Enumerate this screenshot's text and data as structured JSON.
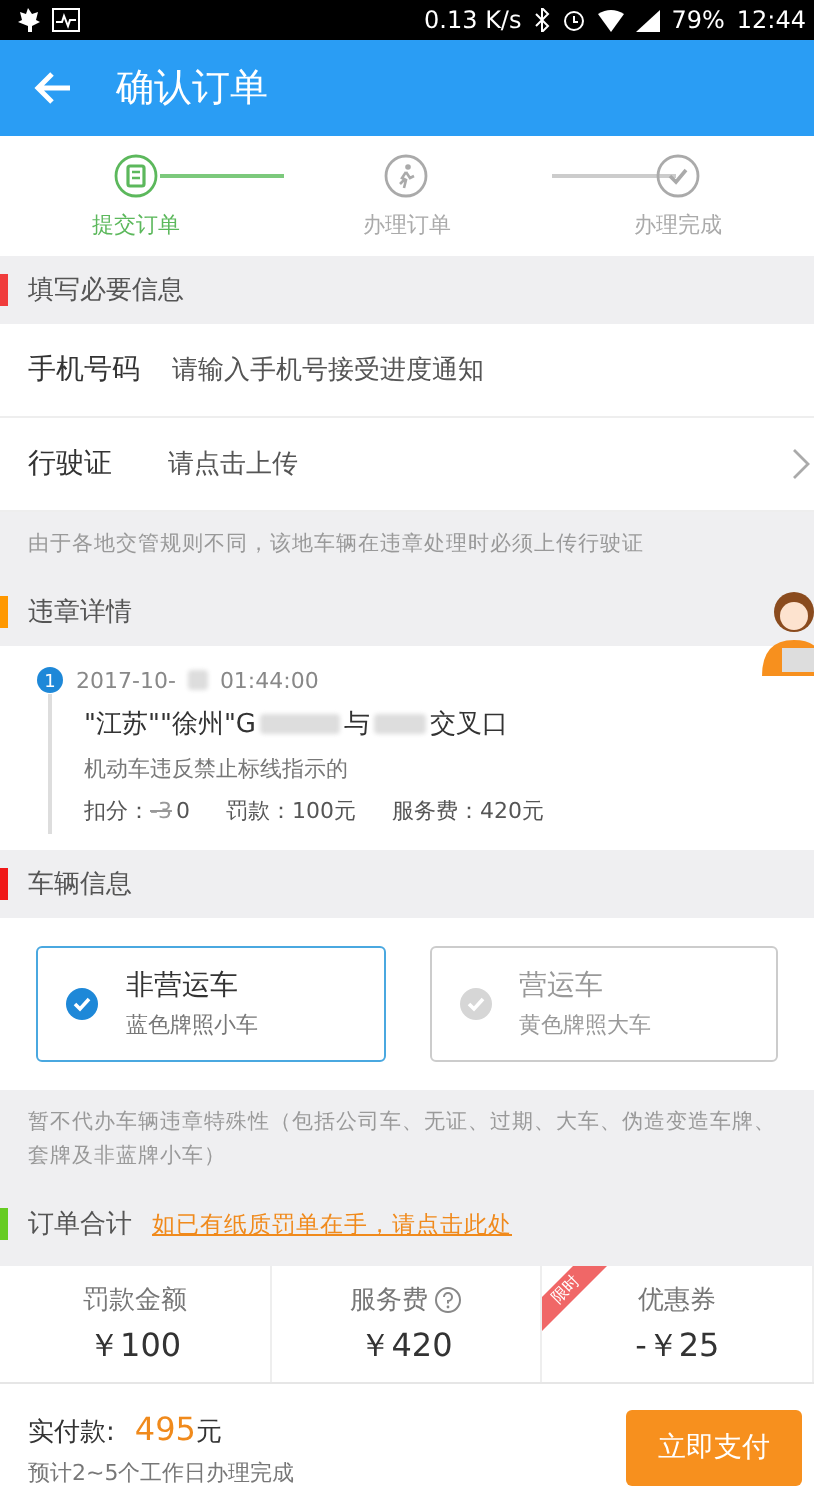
{
  "status_bar": {
    "speed": "0.13 K/s",
    "battery": "79%",
    "time": "12:44"
  },
  "header": {
    "title": "确认订单"
  },
  "steps": [
    {
      "label": "提交订单",
      "selected": true,
      "kind": "form"
    },
    {
      "label": "办理订单",
      "selected": false,
      "kind": "run"
    },
    {
      "label": "办理完成",
      "selected": false,
      "kind": "check"
    }
  ],
  "required_info": {
    "title": "填写必要信息",
    "color": "#f03c3c",
    "fields": [
      {
        "label": "手机号码",
        "placeholder": "请输入手机号接受进度通知",
        "kind": "input"
      },
      {
        "label": "行驶证",
        "placeholder": "请点击上传",
        "kind": "link"
      }
    ],
    "note": "由于各地交管规则不同，该地车辆在违章处理时必须上传行驶证"
  },
  "violations": {
    "title": "违章详情",
    "color": "#ff9800",
    "items": [
      {
        "index": "1",
        "time_parts": [
          "2017-10-",
          "01:44:00"
        ],
        "location_parts": [
          "\"江苏\"\"徐州\"G",
          "与",
          "交叉口"
        ],
        "description": "机动车违反禁止标线指示的",
        "points_label": "扣分：",
        "points_old": "-3",
        "points_new": "0",
        "fine": "罚款：100元",
        "service_fee": "服务费：420元"
      }
    ]
  },
  "vehicle_info": {
    "title": "车辆信息",
    "color": "#f01818",
    "options": [
      {
        "title": "非营运车",
        "subtitle": "蓝色牌照小车",
        "selected": true
      },
      {
        "title": "营运车",
        "subtitle": "黄色牌照大车",
        "selected": false
      }
    ],
    "note": "暂不代办车辆违章特殊性（包括公司车、无证、过期、大车、伪造变造车牌、套牌及非蓝牌小车）"
  },
  "order_total": {
    "title": "订单合计",
    "color": "#66cc22",
    "link": "如已有纸质罚单在手，请点击此处",
    "items": [
      {
        "label": "罚款金额",
        "value": "￥100",
        "kind": "plain"
      },
      {
        "label": "服务费",
        "value": "￥420",
        "kind": "help"
      },
      {
        "label": "优惠券",
        "value": "-￥25",
        "kind": "badge",
        "badge": "限时"
      }
    ]
  },
  "footer": {
    "paid_label": "实付款:",
    "amount": "495",
    "unit": "元",
    "estimate": "预计2~5个工作日办理完成",
    "pay_button": "立即支付"
  }
}
